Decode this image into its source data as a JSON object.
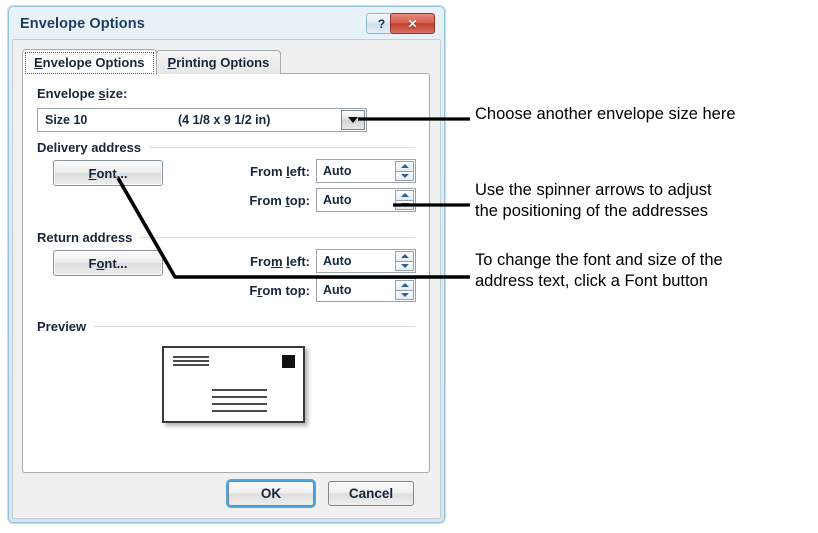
{
  "window": {
    "title": "Envelope Options",
    "help_button": "?",
    "close_button": "✕"
  },
  "tabs": [
    {
      "id": "envelope-options",
      "label_pre": "",
      "accel": "E",
      "label_post": "nvelope Options",
      "active": true
    },
    {
      "id": "printing-options",
      "label_pre": "",
      "accel": "P",
      "label_post": "rinting Options",
      "active": false
    }
  ],
  "envelope_size": {
    "label_pre": "Envelope ",
    "label_accel": "s",
    "label_post": "ize:",
    "selected_name": "Size 10",
    "selected_dimensions": "(4 1/8 x 9 1/2 in)",
    "dropdown_icon": "chevron-down-icon"
  },
  "delivery_address": {
    "group_label": "Delivery address",
    "font_button": {
      "pre": "",
      "accel": "F",
      "post": "ont..."
    },
    "fields": [
      {
        "name": "from-left",
        "label_pre": "From ",
        "label_accel": "l",
        "label_post": "eft:",
        "value": "Auto"
      },
      {
        "name": "from-top",
        "label_pre": "From ",
        "label_accel": "t",
        "label_post": "op:",
        "value": "Auto"
      }
    ]
  },
  "return_address": {
    "group_label": "Return address",
    "font_button": {
      "pre": "F",
      "accel": "o",
      "post": "nt..."
    },
    "fields": [
      {
        "name": "from-left",
        "label_pre": "Fro",
        "label_accel": "m",
        "label_mid": " ",
        "label_accel2": "l",
        "label_post": "eft:",
        "value": "Auto"
      },
      {
        "name": "from-top",
        "label_pre": "F",
        "label_accel": "r",
        "label_post": "om top:",
        "value": "Auto"
      }
    ]
  },
  "preview": {
    "group_label": "Preview",
    "return_address_lines": 3,
    "delivery_address_lines": 4,
    "stamp_icon": "stamp-square-icon"
  },
  "footer": {
    "ok_label": "OK",
    "cancel_label": "Cancel"
  },
  "callouts": [
    {
      "id": "callout-envelope-size",
      "text": "Choose another envelope size here"
    },
    {
      "id": "callout-spinners",
      "text": "Use the spinner arrows to adjust\nthe positioning of the addresses"
    },
    {
      "id": "callout-font",
      "text": "To change the font and size of the\naddress text, click a Font button"
    }
  ],
  "colors": {
    "window_border": "#8fc4dd",
    "title_text": "#1b3c5e",
    "close_button": "#c04030",
    "focus_ring": "#4aa8e0",
    "spinner_arrow": "#33618f"
  }
}
